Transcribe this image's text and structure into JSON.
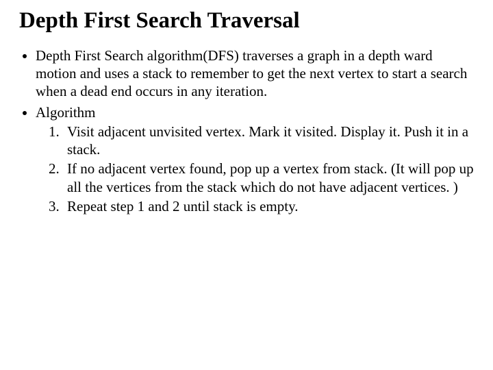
{
  "title": "Depth First Search Traversal",
  "bullets": {
    "intro": "Depth First Search algorithm(DFS) traverses a graph in a depth ward motion and uses a stack to remember to get the next vertex to start a search when a dead end occurs in any iteration.",
    "algo_label": "Algorithm",
    "steps": {
      "s1": "Visit adjacent unvisited vertex. Mark it visited. Display it. Push it in a stack.",
      "s2": "If no adjacent vertex found, pop up a vertex from stack. (It will pop up all the vertices from the stack which do not have adjacent vertices. )",
      "s3": "Repeat step 1 and 2 until stack is empty."
    }
  }
}
